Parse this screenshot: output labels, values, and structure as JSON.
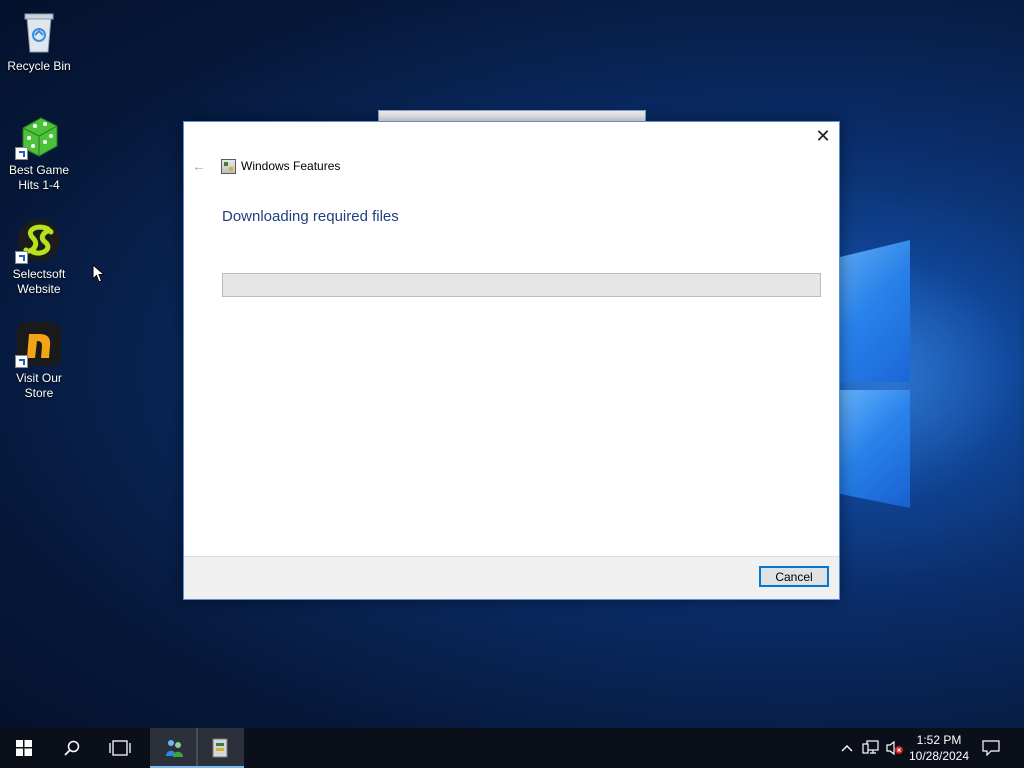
{
  "desktop": {
    "icons": [
      {
        "label": "Recycle Bin"
      },
      {
        "label": "Best Game Hits 1-4"
      },
      {
        "label": "Selectsoft Website"
      },
      {
        "label": "Visit Our Store"
      }
    ]
  },
  "dialog": {
    "title": "Windows Features",
    "heading": "Downloading required files",
    "progress_percent": 0,
    "cancel_label": "Cancel",
    "close_glyph": "✕",
    "back_glyph": "←"
  },
  "taskbar": {
    "clock_time": "1:52 PM",
    "clock_date": "10/28/2024",
    "icons": [
      "windows-start-icon",
      "search-icon",
      "task-view-icon",
      "network-people-icon",
      "windows-features-icon"
    ],
    "tray_icons": [
      "chevron-up-icon",
      "network-icon",
      "volume-muted-icon",
      "notification-icon"
    ]
  },
  "colors": {
    "accent": "#0078d7",
    "heading": "#1e3f82",
    "taskbar": "#0a0f1a"
  }
}
